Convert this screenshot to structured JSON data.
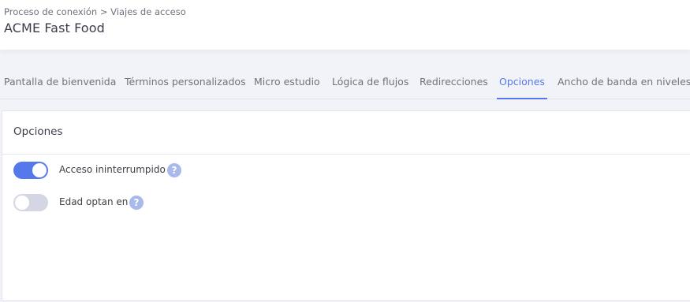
{
  "header": {
    "breadcrumb": "Proceso de conexión > Viajes de acceso",
    "title": "ACME Fast Food"
  },
  "tabs": [
    {
      "label": "Pantalla de bienvenida",
      "active": false
    },
    {
      "label": "Términos personalizados",
      "active": false
    },
    {
      "label": "Micro estudio",
      "active": false
    },
    {
      "label": "Lógica de flujos",
      "active": false
    },
    {
      "label": "Redirecciones",
      "active": false
    },
    {
      "label": "Opciones",
      "active": true
    },
    {
      "label": "Ancho de banda en niveles",
      "active": false
    }
  ],
  "panel": {
    "title": "Opciones",
    "options": [
      {
        "label": "Acceso ininterrumpido",
        "enabled": true,
        "help_icon": "question-mark",
        "help_glyph": "?"
      },
      {
        "label": "Edad optan en",
        "enabled": false,
        "help_icon": "question-mark",
        "help_glyph": "?"
      }
    ]
  },
  "colors": {
    "accent": "#5578eb",
    "toggle_off": "#d5d6e3",
    "help_icon": "#a9b9ea"
  }
}
